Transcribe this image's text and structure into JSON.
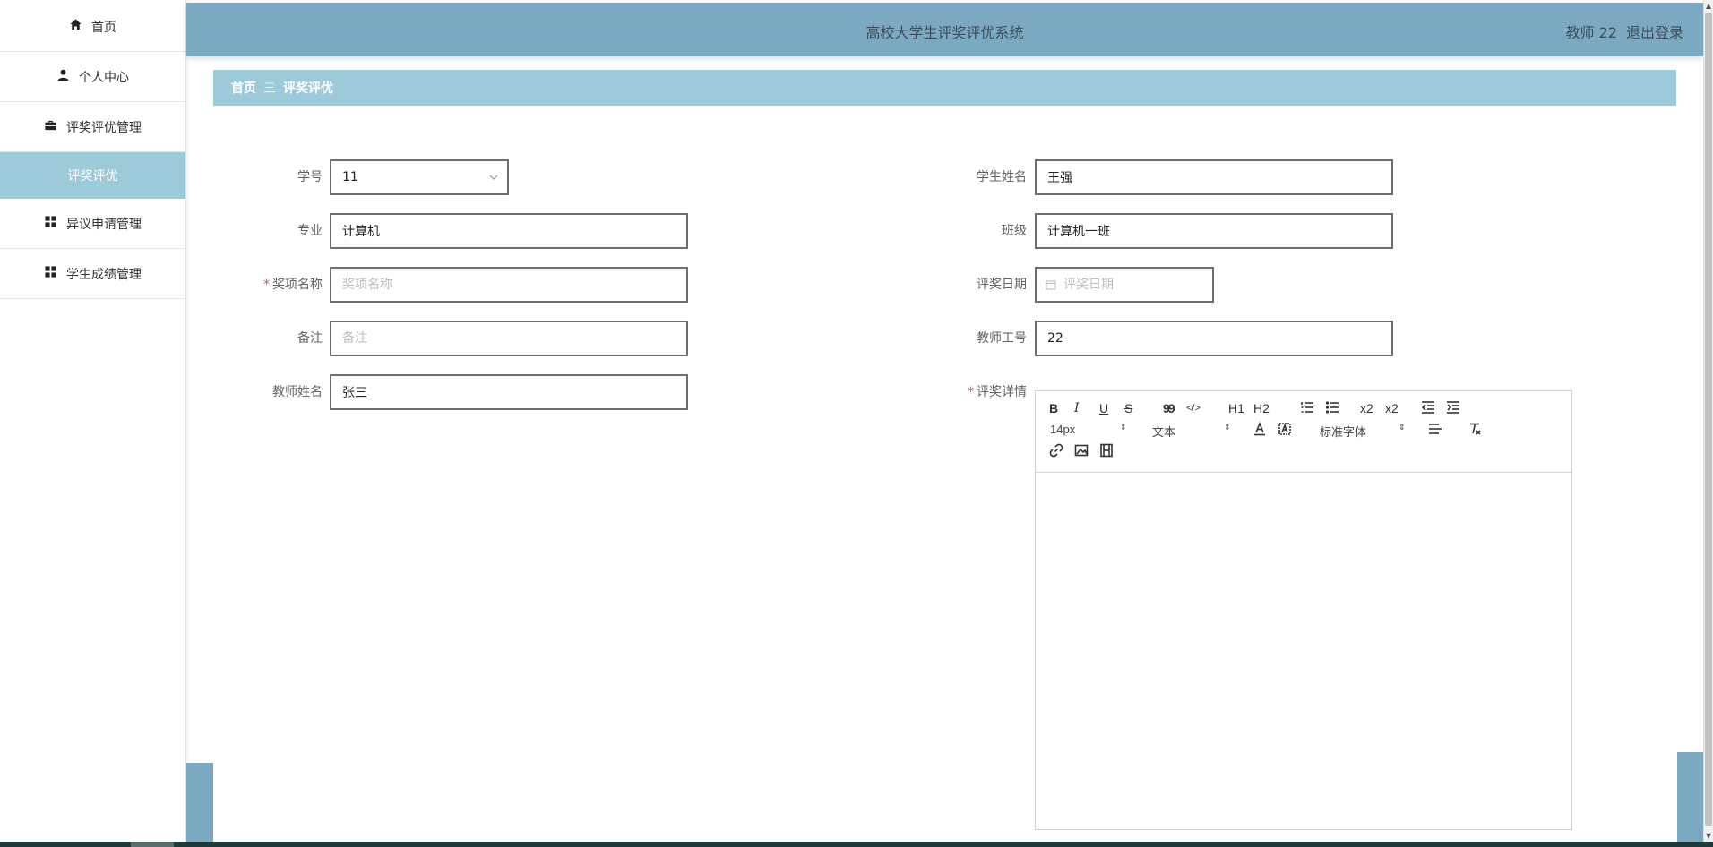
{
  "header": {
    "title": "高校大学生评奖评优系统",
    "user_label": "教师 22",
    "logout_label": "退出登录"
  },
  "sidebar": {
    "items": [
      {
        "label": "首页",
        "icon": "home-icon"
      },
      {
        "label": "个人中心",
        "icon": "user-icon"
      },
      {
        "label": "评奖评优管理",
        "icon": "briefcase-icon"
      },
      {
        "label": "评奖评优",
        "icon": ""
      },
      {
        "label": "异议申请管理",
        "icon": "grid-icon"
      },
      {
        "label": "学生成绩管理",
        "icon": "grid-icon"
      }
    ]
  },
  "breadcrumb": {
    "home": "首页",
    "separator": "三",
    "current": "评奖评优"
  },
  "form": {
    "student_id": {
      "label": "学号",
      "value": "11"
    },
    "student_name": {
      "label": "学生姓名",
      "value": "王强"
    },
    "major": {
      "label": "专业",
      "value": "计算机"
    },
    "class": {
      "label": "班级",
      "value": "计算机一班"
    },
    "award_name": {
      "label": "奖项名称",
      "placeholder": "奖项名称",
      "required": "*"
    },
    "award_date": {
      "label": "评奖日期",
      "placeholder": "评奖日期"
    },
    "remark": {
      "label": "备注",
      "placeholder": "备注"
    },
    "teacher_id": {
      "label": "教师工号",
      "value": "22"
    },
    "teacher_name": {
      "label": "教师姓名",
      "value": "张三"
    },
    "award_detail": {
      "label": "评奖详情",
      "required": "*"
    }
  },
  "editor": {
    "buttons": {
      "bold": "B",
      "italic": "I",
      "underline": "U",
      "strike": "S",
      "quote": "99",
      "code": "</>",
      "h1": "H1",
      "h2": "H2",
      "sub": "x2",
      "sup": "x2"
    },
    "font_size": "14px",
    "block_type": "文本",
    "font_family": "标准字体",
    "arrow": "⇕"
  }
}
